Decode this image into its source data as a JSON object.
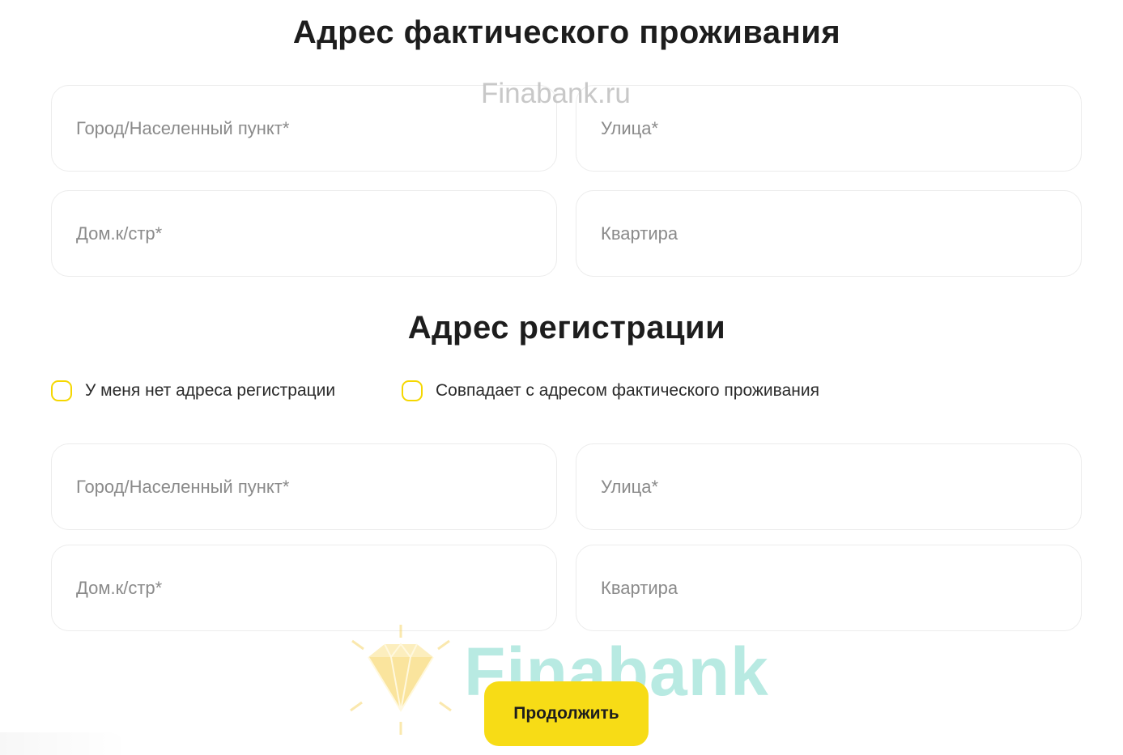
{
  "watermark": {
    "site": "Finabank.ru",
    "logo_text": "Finabank"
  },
  "actual_address": {
    "title": "Адрес фактического проживания",
    "fields": {
      "city": {
        "placeholder": "Город/Населенный пункт*",
        "value": ""
      },
      "street": {
        "placeholder": "Улица*",
        "value": ""
      },
      "house": {
        "placeholder": "Дом.к/стр*",
        "value": ""
      },
      "apartment": {
        "placeholder": "Квартира",
        "value": ""
      }
    }
  },
  "registration_address": {
    "title": "Адрес регистрации",
    "checkboxes": {
      "no_registration": {
        "label": "У меня нет адреса регистрации",
        "checked": false
      },
      "same_as_actual": {
        "label": "Совпадает с адресом фактического проживания",
        "checked": false
      }
    },
    "fields": {
      "city": {
        "placeholder": "Город/Населенный пункт*",
        "value": ""
      },
      "street": {
        "placeholder": "Улица*",
        "value": ""
      },
      "house": {
        "placeholder": "Дом.к/стр*",
        "value": ""
      },
      "apartment": {
        "placeholder": "Квартира",
        "value": ""
      }
    }
  },
  "submit": {
    "label": "Продолжить"
  },
  "colors": {
    "accent_yellow": "#f7dc16",
    "checkbox_border": "#f5d700",
    "field_border": "#ececec",
    "placeholder": "#8a8a8a",
    "watermark_teal": "#7fd9cc"
  }
}
